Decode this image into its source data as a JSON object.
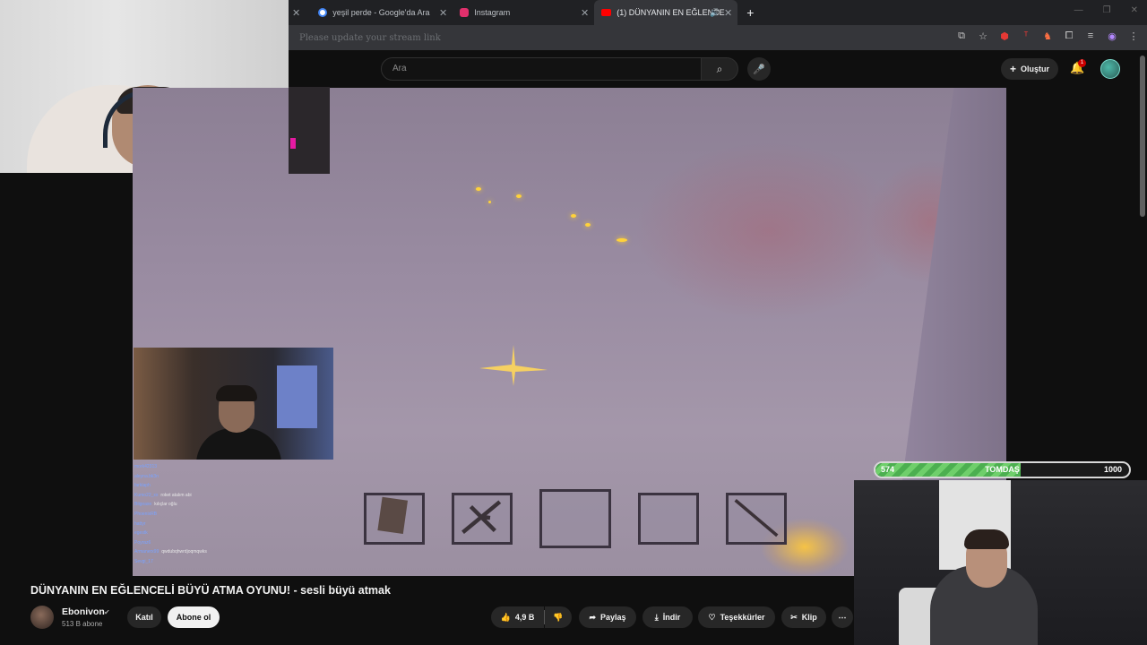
{
  "browser": {
    "tabs": [
      {
        "title": "yeşil perde - Google'da Ara",
        "icon": "google-icon",
        "color": "#4285f4"
      },
      {
        "title": "Instagram",
        "icon": "instagram-icon",
        "color": "#e1306c"
      },
      {
        "title": "(1) DÜNYANIN EN EĞLENCE",
        "icon": "youtube-icon",
        "color": "#ff0000",
        "active": true
      }
    ],
    "url": "Please update your stream link"
  },
  "youtube": {
    "search_placeholder": "Ara",
    "create_label": "Oluştur",
    "notification_count": "1",
    "video_title": "DÜNYANIN EN EĞLENCELİ BÜYÜ ATMA OYUNU! - sesli büyü atmak",
    "channel_name": "Ebonivon",
    "subscribers": "513 B abone",
    "join_label": "Katıl",
    "subscribe_label": "Abone ol",
    "likes": "4,9 B",
    "share_label": "Paylaş",
    "download_label": "İndir",
    "thanks_label": "Teşekkürler",
    "clip_label": "Klip",
    "more_icon": "more-icon"
  },
  "overlay": {
    "goal_current": "574",
    "goal_name": "TOMDAŞ",
    "goal_target": "1000",
    "goal_fraction": 0.574,
    "chat": [
      {
        "user": "mork42313",
        "msg": ""
      },
      {
        "user": "aleyna.bk3n",
        "msg": ""
      },
      {
        "user": "farklaph",
        "msg": ""
      },
      {
        "user": "Kumo22_xx",
        "msg": "roket atalım abi"
      },
      {
        "user": "Bilgeaxe",
        "msg": "kılıçlar oğlu"
      },
      {
        "user": "PhoenixRB",
        "msg": ""
      },
      {
        "user": "hattyr",
        "msg": ""
      },
      {
        "user": "egestk",
        "msg": ""
      },
      {
        "user": "Poyraz6",
        "msg": ""
      },
      {
        "user": "Armanerx99",
        "msg": "qwdubqhwrdjoqmqwks"
      },
      {
        "user": "Sevgi_17",
        "msg": ""
      }
    ]
  }
}
